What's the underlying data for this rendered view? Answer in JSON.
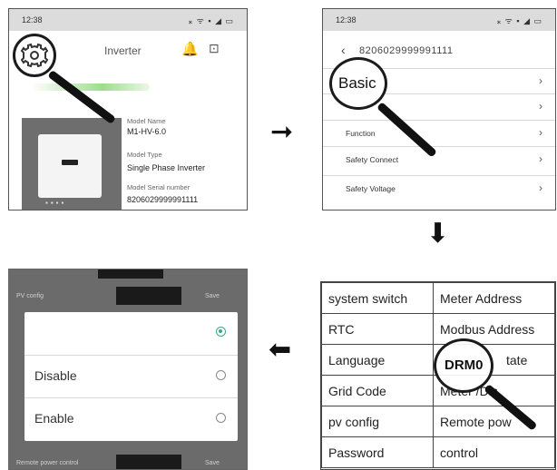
{
  "panel1": {
    "status_time": "12:38",
    "status_icons": "⁎ ᯤ ▪ ◢ ▭",
    "title": "Inverter",
    "model_name_label": "Model Name",
    "model_name_value": "M1-HV-6.0",
    "model_type_label": "Model Type",
    "model_type_value": "Single Phase Inverter",
    "serial_label": "Model Serial number",
    "serial_value": "8206029999991111"
  },
  "panel2": {
    "status_time": "12:38",
    "status_icons": "⁎ ᯤ ▪ ◢ ▭",
    "serial": "8206029999991111",
    "magnifier_text": "Basic",
    "rows": [
      {
        "label": ""
      },
      {
        "label": ""
      },
      {
        "label": "Function"
      },
      {
        "label": "Safety Connect"
      },
      {
        "label": "Safety Voltage"
      }
    ]
  },
  "panel3": {
    "magnifier_text": "DRM0",
    "rows": [
      {
        "left": "system switch",
        "right": "Meter Address"
      },
      {
        "left": "RTC",
        "right": "Modbus Address"
      },
      {
        "left": "Language",
        "right": "tate"
      },
      {
        "left": "Grid Code",
        "right": "Meter        /Dis"
      },
      {
        "left": "pv config",
        "right": "Remote pow"
      },
      {
        "left": "Password",
        "right": "control"
      }
    ]
  },
  "panel4": {
    "bg_label_top": "PV config",
    "bg_save_top": "Save",
    "bg_label_bottom": "Remote power control",
    "bg_save_bottom": "Save",
    "options": [
      {
        "label": "",
        "selected": true
      },
      {
        "label": "Disable",
        "selected": false
      },
      {
        "label": "Enable",
        "selected": false
      }
    ]
  },
  "arrows": {
    "right": "➞",
    "down": "⬇",
    "left": "⬅"
  },
  "icons": {
    "settings": "gear-icon",
    "bell": "bell-icon",
    "device_list": "device-search-icon",
    "back": "back-arrow-icon",
    "chevron": "chevron-right-icon",
    "chevron_glyph": "›",
    "bell_glyph": "🔔",
    "device_glyph": "⊡",
    "back_glyph": "‹"
  },
  "colors": {
    "accent_green": "#3aa887",
    "highlight_green": "#9fdc8e"
  }
}
